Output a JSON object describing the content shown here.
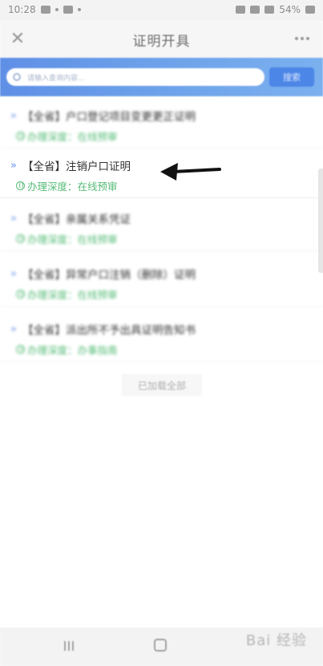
{
  "status_bar": {
    "time": "10:28",
    "battery": "54%"
  },
  "header": {
    "title": "证明开具",
    "close_icon": "close-icon",
    "more_icon": "more-icon"
  },
  "search": {
    "placeholder": "请输入查询内容...",
    "button_label": "搜索"
  },
  "results": [
    {
      "title": "【全省】户口登记项目变更更正证明",
      "depth": "办理深度：在线预审"
    },
    {
      "title": "【全省】注销户口证明",
      "depth": "办理深度：在线预审"
    },
    {
      "title": "【全省】亲属关系凭证",
      "depth": "办理深度：在线预审"
    },
    {
      "title": "【全省】异常户口注销（删除）证明",
      "depth": "办理深度：在线预审"
    },
    {
      "title": "【全省】派出所不予出具证明告知书",
      "depth": "办理深度：办事指南"
    }
  ],
  "footer": {
    "loaded_all": "已加载全部"
  },
  "watermark": "Bai 经验"
}
